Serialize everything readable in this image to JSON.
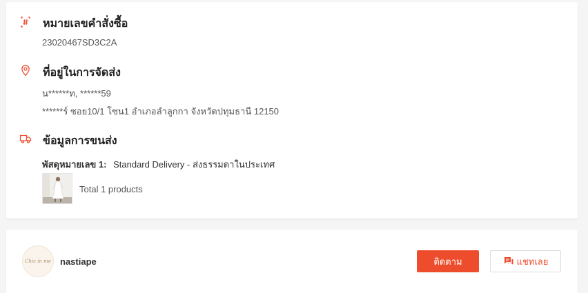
{
  "order": {
    "number_title": "หมายเลขคำสั่งซื้อ",
    "number_value": "23020467SD3C2A",
    "number_icon": "hash-icon",
    "address_title": "ที่อยู่ในการจัดส่ง",
    "address_icon": "location-pin-icon",
    "recipient": "น******ท, ******59",
    "address_full": "******ร์ ซอย10/1 โซน1 อำเภอลำลูกกา จังหวัดปทุมธานี 12150",
    "shipping_title": "ข้อมูลการขนส่ง",
    "shipping_icon": "truck-icon",
    "parcel_label": "พัสดุหมายเลข 1:",
    "parcel_service": "Standard Delivery - ส่งธรรมดาในประเทศ",
    "product_count": "Total 1 products"
  },
  "shop": {
    "name": "nastiape",
    "avatar_text": "Chic in me",
    "follow_label": "ติดตาม",
    "chat_label": "แชทเลย",
    "chat_icon": "chat-bubble-icon"
  },
  "colors": {
    "accent": "#ee4d2d",
    "background": "#f5f5f5",
    "card": "#ffffff"
  }
}
